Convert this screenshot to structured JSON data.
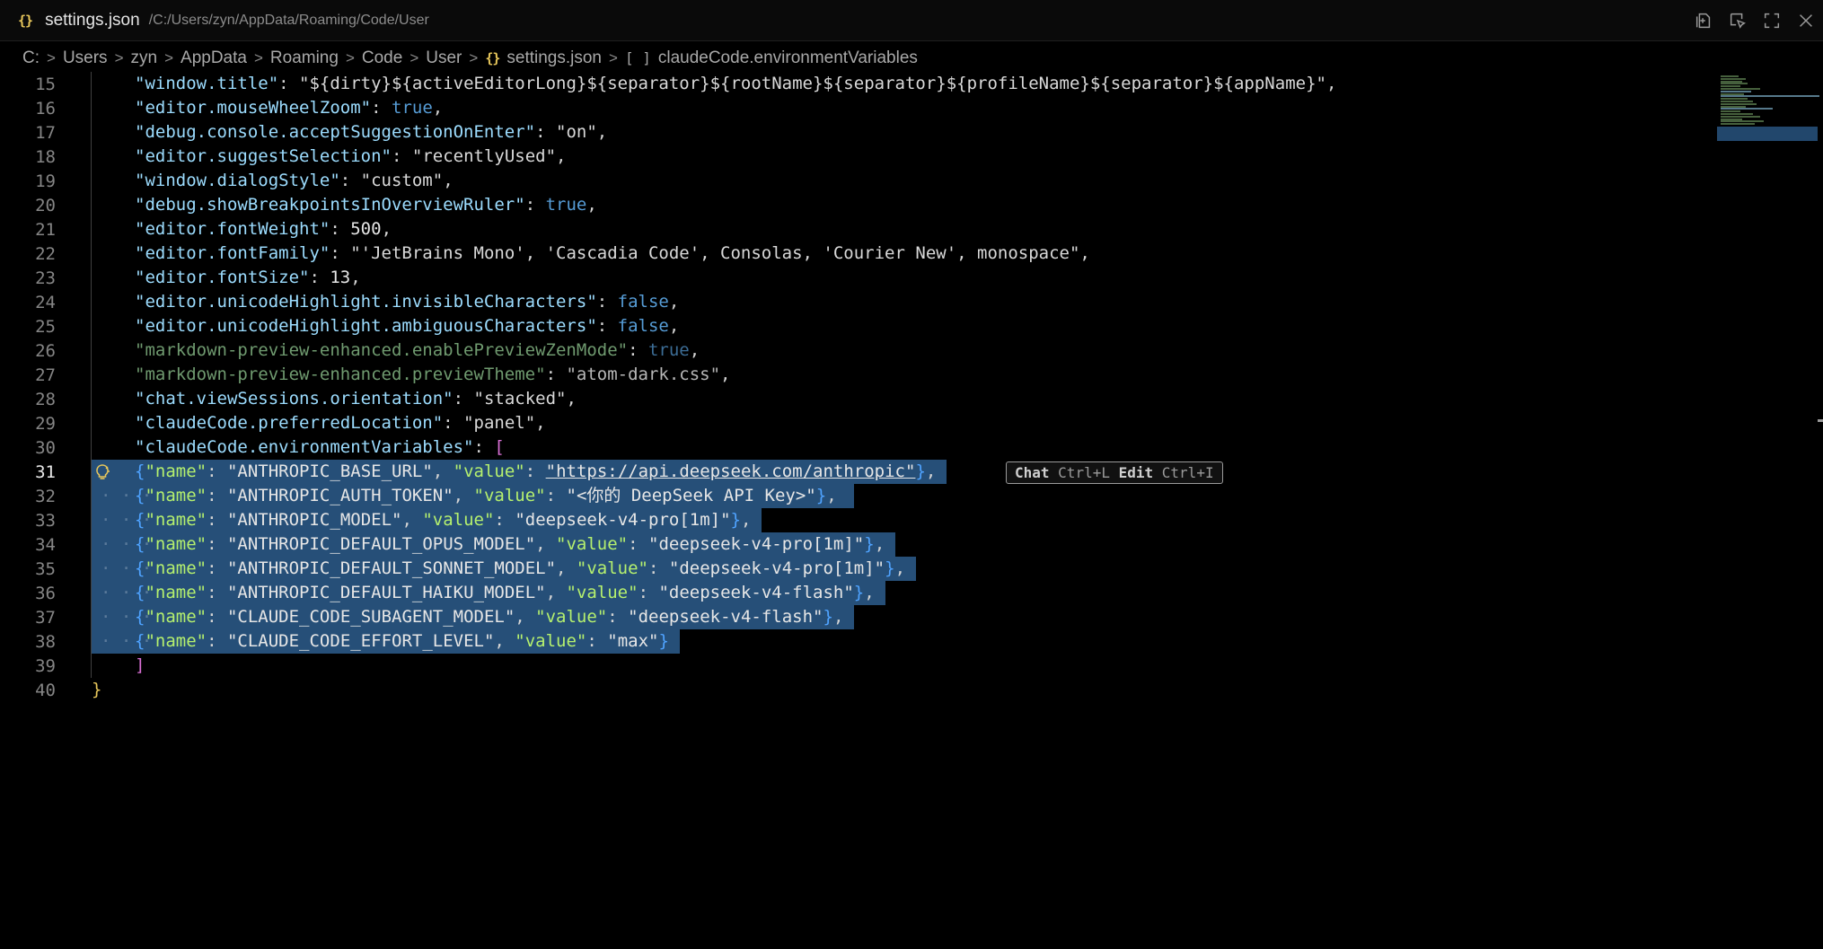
{
  "titlebar": {
    "icon": "json-braces-icon",
    "file_icon_text": "{}",
    "file_name": "settings.json",
    "path": "/C:/Users/zyn/AppData/Roaming/Code/User",
    "actions": [
      "open-changes-icon",
      "inspect-icon",
      "maximize-icon",
      "close-icon"
    ]
  },
  "breadcrumb": {
    "items": [
      "C:",
      "Users",
      "zyn",
      "AppData",
      "Roaming",
      "Code",
      "User"
    ],
    "file_icon_text": "{}",
    "file": "settings.json",
    "symbol_icon_text": "[ ]",
    "symbol": "claudeCode.environmentVariables"
  },
  "editor": {
    "active_line": 31,
    "lines": [
      {
        "n": "15",
        "key": "\"window.title\"",
        "value": "\"${dirty}${activeEditorLong}${separator}${rootName}${separator}${profileName}${separator}${appName}\"",
        "vtype": "str",
        "comma": ","
      },
      {
        "n": "16",
        "key": "\"editor.mouseWheelZoom\"",
        "value": "true",
        "vtype": "bool",
        "comma": ","
      },
      {
        "n": "17",
        "key": "\"debug.console.acceptSuggestionOnEnter\"",
        "value": "\"on\"",
        "vtype": "str",
        "comma": ","
      },
      {
        "n": "18",
        "key": "\"editor.suggestSelection\"",
        "value": "\"recentlyUsed\"",
        "vtype": "str",
        "comma": ","
      },
      {
        "n": "19",
        "key": "\"window.dialogStyle\"",
        "value": "\"custom\"",
        "vtype": "str",
        "comma": ","
      },
      {
        "n": "20",
        "key": "\"debug.showBreakpointsInOverviewRuler\"",
        "value": "true",
        "vtype": "bool",
        "comma": ","
      },
      {
        "n": "21",
        "key": "\"editor.fontWeight\"",
        "value": "500",
        "vtype": "num",
        "comma": ","
      },
      {
        "n": "22",
        "key": "\"editor.fontFamily\"",
        "value": "\"'JetBrains Mono', 'Cascadia Code', Consolas, 'Courier New', monospace\"",
        "vtype": "str",
        "comma": ","
      },
      {
        "n": "23",
        "key": "\"editor.fontSize\"",
        "value": "13",
        "vtype": "num",
        "comma": ","
      },
      {
        "n": "24",
        "key": "\"editor.unicodeHighlight.invisibleCharacters\"",
        "value": "false",
        "vtype": "bool",
        "comma": ","
      },
      {
        "n": "25",
        "key": "\"editor.unicodeHighlight.ambiguousCharacters\"",
        "value": "false",
        "vtype": "bool",
        "comma": ","
      },
      {
        "n": "26",
        "key": "\"markdown-preview-enhanced.enablePreviewZenMode\"",
        "value": "true",
        "vtype": "bool",
        "comma": ",",
        "dim": true
      },
      {
        "n": "27",
        "key": "\"markdown-preview-enhanced.previewTheme\"",
        "value": "\"atom-dark.css\"",
        "vtype": "str",
        "comma": ",",
        "dim": true
      },
      {
        "n": "28",
        "key": "\"chat.viewSessions.orientation\"",
        "value": "\"stacked\"",
        "vtype": "str",
        "comma": ","
      },
      {
        "n": "29",
        "key": "\"claudeCode.preferredLocation\"",
        "value": "\"panel\"",
        "vtype": "str",
        "comma": ","
      },
      {
        "n": "30",
        "key": "\"claudeCode.environmentVariables\"",
        "value": "[",
        "vtype": "bracket",
        "comma": ""
      }
    ],
    "env_lines": [
      {
        "n": "31",
        "name": "\"ANTHROPIC_BASE_URL\"",
        "value": "\"https://api.deepseek.com/anthropic\"",
        "comma": ",",
        "url": true
      },
      {
        "n": "32",
        "name": "\"ANTHROPIC_AUTH_TOKEN\"",
        "value": "\"<你的 DeepSeek API Key>\"",
        "comma": ","
      },
      {
        "n": "33",
        "name": "\"ANTHROPIC_MODEL\"",
        "value": "\"deepseek-v4-pro[1m]\"",
        "comma": ","
      },
      {
        "n": "34",
        "name": "\"ANTHROPIC_DEFAULT_OPUS_MODEL\"",
        "value": "\"deepseek-v4-pro[1m]\"",
        "comma": ","
      },
      {
        "n": "35",
        "name": "\"ANTHROPIC_DEFAULT_SONNET_MODEL\"",
        "value": "\"deepseek-v4-pro[1m]\"",
        "comma": ","
      },
      {
        "n": "36",
        "name": "\"ANTHROPIC_DEFAULT_HAIKU_MODEL\"",
        "value": "\"deepseek-v4-flash\"",
        "comma": ","
      },
      {
        "n": "37",
        "name": "\"CLAUDE_CODE_SUBAGENT_MODEL\"",
        "value": "\"deepseek-v4-flash\"",
        "comma": ","
      },
      {
        "n": "38",
        "name": "\"CLAUDE_CODE_EFFORT_LEVEL\"",
        "value": "\"max\"",
        "comma": ""
      }
    ],
    "env_key_name": "\"name\"",
    "env_key_value": "\"value\"",
    "tail_lines": [
      {
        "n": "39",
        "text": "]"
      },
      {
        "n": "40",
        "text": "}"
      }
    ]
  },
  "inline_hint": {
    "chat_label": "Chat",
    "chat_shortcut": "Ctrl+L",
    "edit_label": "Edit",
    "edit_shortcut": "Ctrl+I"
  },
  "colors": {
    "selection": "#264f78",
    "key": "#9cdcfe",
    "boolean": "#569cd6",
    "brace": "#e8c75b",
    "bracket": "#da70d6",
    "env_key": "#b5f06e"
  }
}
